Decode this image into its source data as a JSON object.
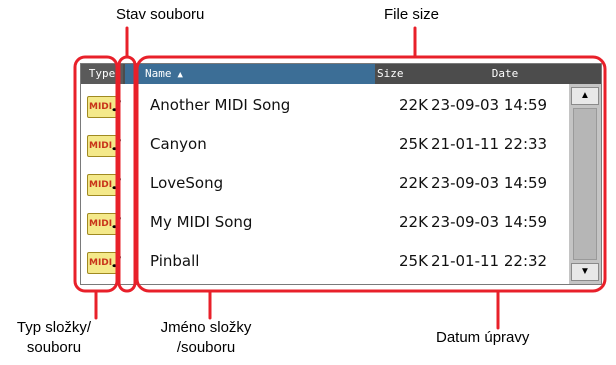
{
  "callouts": {
    "stav_souboru": "Stav souboru",
    "file_size": "File size",
    "typ_line1": "Typ složky/",
    "typ_line2": "souboru",
    "jmeno_line1": "Jméno složky",
    "jmeno_line2": "/souboru",
    "datum": "Datum úpravy"
  },
  "header": {
    "type": "Type",
    "name": "Name",
    "sort_arrow": "▲",
    "size": "Size",
    "date": "Date"
  },
  "files": [
    {
      "type_badge": "MIDI",
      "name": "Another MIDI Song",
      "size": "22K",
      "date": "23-09-03 14:59"
    },
    {
      "type_badge": "MIDI",
      "name": "Canyon",
      "size": "25K",
      "date": "21-01-11 22:33"
    },
    {
      "type_badge": "MIDI",
      "name": "LoveSong",
      "size": "22K",
      "date": "23-09-03 14:59"
    },
    {
      "type_badge": "MIDI",
      "name": "My MIDI Song",
      "size": "22K",
      "date": "23-09-03 14:59"
    },
    {
      "type_badge": "MIDI",
      "name": "Pinball",
      "size": "25K",
      "date": "21-01-11 22:32"
    }
  ],
  "scrollbar": {
    "up": "▲",
    "down": "▼"
  },
  "colors": {
    "callout_outline": "#e8202a",
    "header_bg": "#4c4c4c",
    "name_header_bg": "#3c6e96"
  }
}
